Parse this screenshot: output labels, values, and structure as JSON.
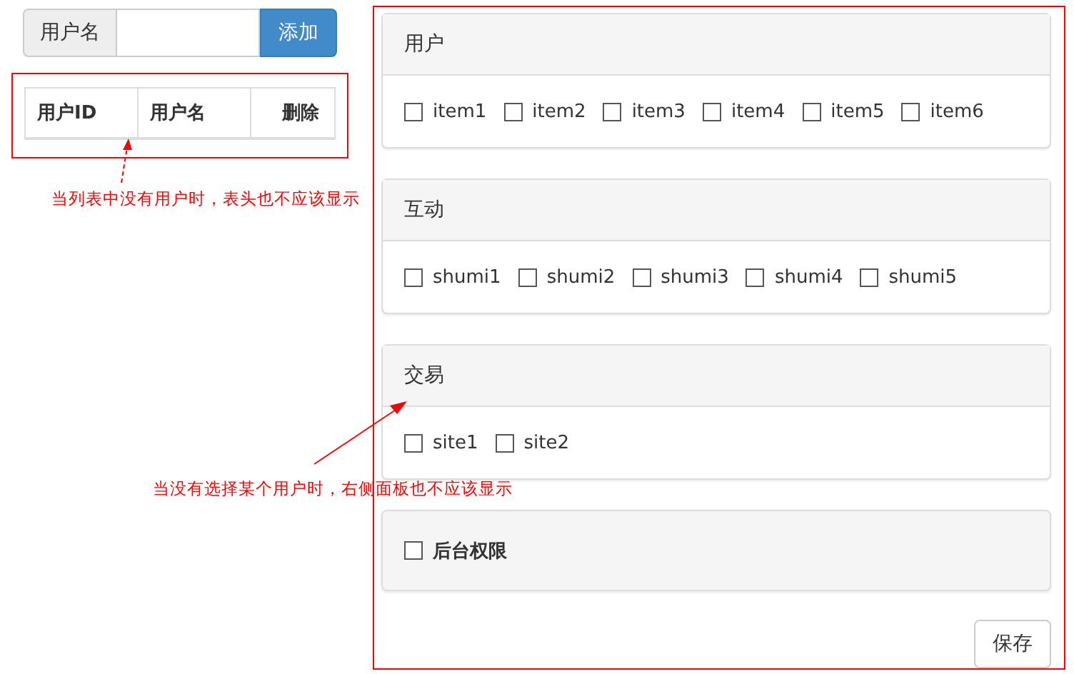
{
  "user_form": {
    "label": "用户名",
    "button": "添加"
  },
  "user_table": {
    "columns": [
      "用户ID",
      "用户名",
      "删除"
    ]
  },
  "annotations": [
    {
      "text": "当列表中没有用户时，表头也不应该显示"
    },
    {
      "text": "当没有选择某个用户时，右侧面板也不应该显示"
    }
  ],
  "permission_groups": [
    {
      "title": "用户",
      "items": [
        {
          "label": "item1",
          "checked": false
        },
        {
          "label": "item2",
          "checked": false
        },
        {
          "label": "item3",
          "checked": false
        },
        {
          "label": "item4",
          "checked": false
        },
        {
          "label": "item5",
          "checked": false
        },
        {
          "label": "item6",
          "checked": false
        }
      ]
    },
    {
      "title": "互动",
      "items": [
        {
          "label": "shumi1",
          "checked": false
        },
        {
          "label": "shumi2",
          "checked": false
        },
        {
          "label": "shumi3",
          "checked": false
        },
        {
          "label": "shumi4",
          "checked": false
        },
        {
          "label": "shumi5",
          "checked": false
        }
      ]
    },
    {
      "title": "交易",
      "items": [
        {
          "label": "site1",
          "checked": false
        },
        {
          "label": "site2",
          "checked": false
        }
      ]
    }
  ],
  "admin_permission": {
    "label": "后台权限",
    "checked": false
  },
  "save_button": "保存"
}
